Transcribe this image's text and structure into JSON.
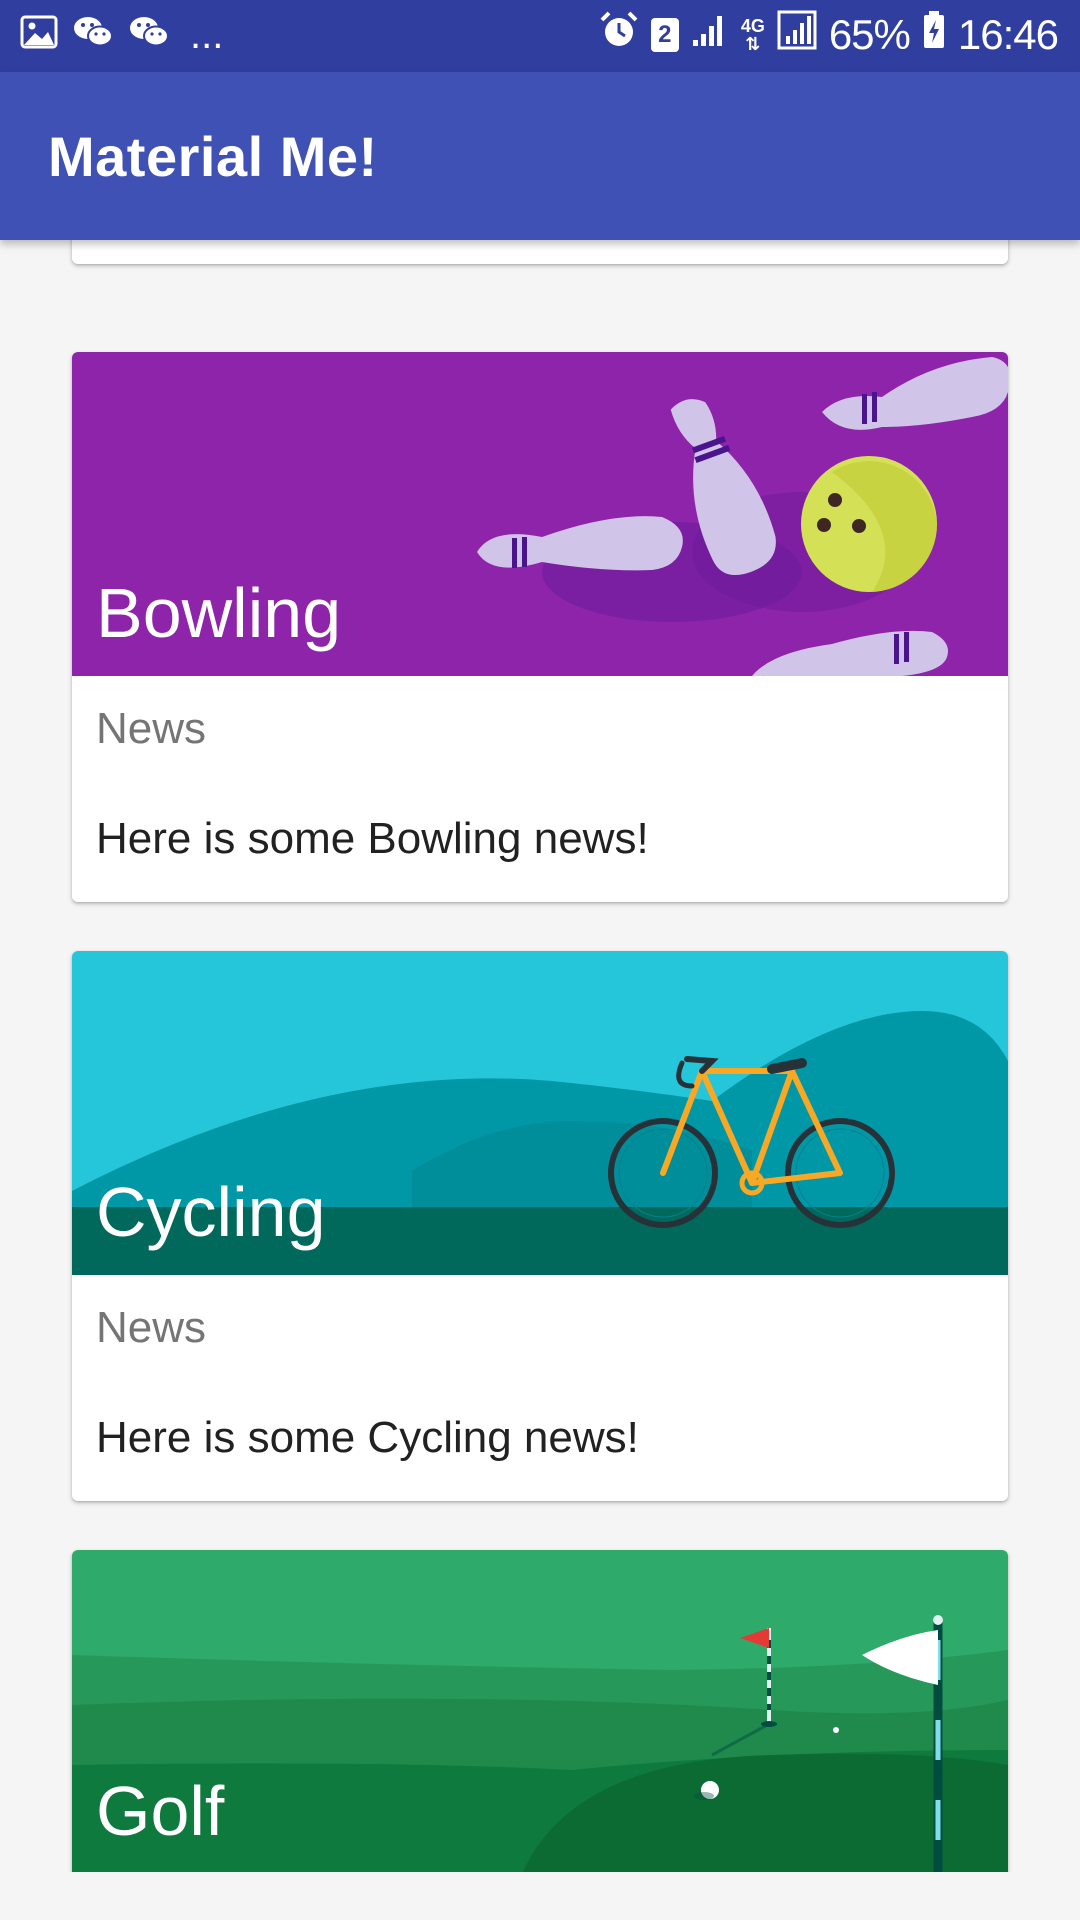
{
  "status_bar": {
    "left_icons": [
      "image-icon",
      "wechat-icon",
      "wechat-icon"
    ],
    "ellipsis": "...",
    "sim_badge": "2",
    "network_type": "4G",
    "battery_percent": "65%",
    "time": "16:46"
  },
  "app_bar": {
    "title": "Material Me!",
    "color": "#3f51b5",
    "status_color": "#303f9f"
  },
  "cards": [
    {
      "title": "Bowling",
      "subtitle": "News",
      "info": "Here is some Bowling news!",
      "image": "bowling-image",
      "color": "#8e24aa"
    },
    {
      "title": "Cycling",
      "subtitle": "News",
      "info": "Here is some Cycling news!",
      "image": "cycling-image",
      "color": "#26c6da"
    },
    {
      "title": "Golf",
      "image": "golf-image",
      "color": "#2e7d32"
    }
  ]
}
